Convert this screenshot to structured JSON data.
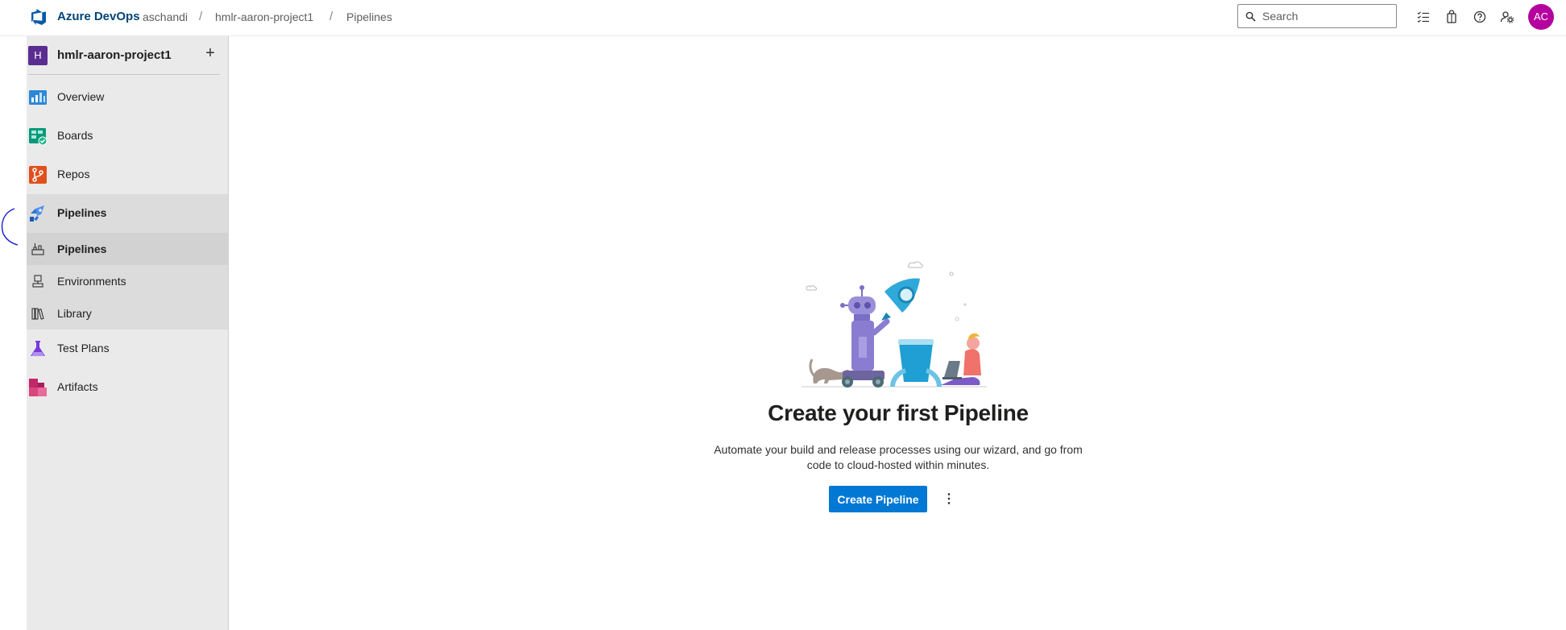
{
  "header": {
    "brand": "Azure DevOps",
    "breadcrumbs": [
      {
        "label": "aschandi"
      },
      {
        "label": "hmlr-aaron-project1"
      },
      {
        "label": "Pipelines"
      }
    ],
    "separator": "/",
    "search_placeholder": "Search",
    "icons": [
      "work-items-icon",
      "marketplace-bag-icon",
      "help-icon",
      "user-settings-icon"
    ],
    "avatar_initials": "AC",
    "avatar_color": "#b4009e"
  },
  "sidebar": {
    "project_initial": "H",
    "project_name": "hmlr-aaron-project1",
    "add_label": "+",
    "items": [
      {
        "label": "Overview",
        "icon": "overview-icon"
      },
      {
        "label": "Boards",
        "icon": "boards-icon"
      },
      {
        "label": "Repos",
        "icon": "repos-icon"
      },
      {
        "label": "Pipelines",
        "icon": "pipelines-icon"
      },
      {
        "label": "Test Plans",
        "icon": "test-plans-icon"
      },
      {
        "label": "Artifacts",
        "icon": "artifacts-icon"
      }
    ],
    "pipelines_subitems": [
      {
        "label": "Pipelines",
        "icon": "pipelines-sub-icon"
      },
      {
        "label": "Environments",
        "icon": "environments-icon"
      },
      {
        "label": "Library",
        "icon": "library-icon"
      }
    ]
  },
  "main": {
    "title": "Create your first Pipeline",
    "description": "Automate your build and release processes using our wizard, and go from code to cloud-hosted within minutes.",
    "primary_button": "Create Pipeline",
    "more_button": "⋮"
  },
  "colors": {
    "accent": "#0078d4",
    "brand_text": "#004578",
    "sidebar_bg": "#eaeaea",
    "project_avatar": "#5c2d91"
  }
}
